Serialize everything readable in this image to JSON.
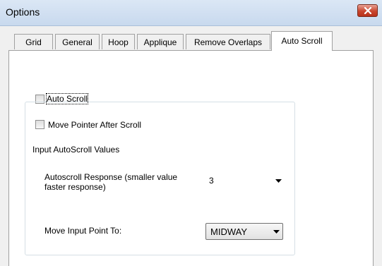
{
  "window": {
    "title": "Options"
  },
  "tabs": [
    {
      "label": "Grid"
    },
    {
      "label": "General"
    },
    {
      "label": "Hoop"
    },
    {
      "label": "Applique"
    },
    {
      "label": "Remove Overlaps"
    },
    {
      "label": "Auto Scroll",
      "active": true
    }
  ],
  "auto_scroll": {
    "auto_scroll_checkbox": {
      "label": "Auto Scroll",
      "checked": false
    },
    "move_pointer_checkbox": {
      "label": "Move Pointer After Scroll",
      "checked": false
    },
    "group": {
      "title": "Input AutoScroll Values",
      "response_label": "Autoscroll Response (smaller value faster response)",
      "response_value": "3",
      "move_point_label": "Move Input Point To:",
      "move_point_value": "MIDWAY"
    }
  },
  "icons": {
    "close": "close-icon",
    "dropdown": "chevron-down-icon"
  },
  "colors": {
    "close_button": "#c9462f",
    "titlebar": "#dbe7f5",
    "panel": "#ffffff",
    "window": "#f0f0f0"
  }
}
